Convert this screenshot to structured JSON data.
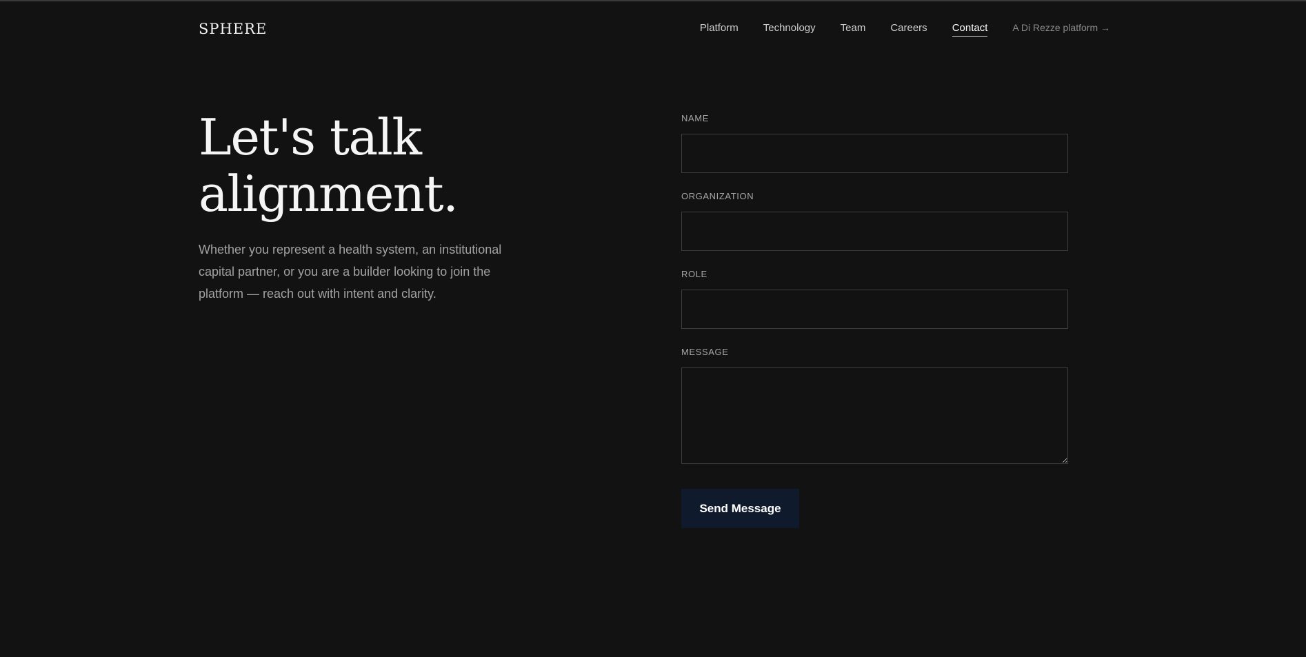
{
  "header": {
    "logo": "SPHERE",
    "nav": [
      "Platform",
      "Technology",
      "Team",
      "Careers",
      "Contact"
    ],
    "active_nav": "Contact",
    "external_link": "A Di Rezze platform →"
  },
  "hero": {
    "title_line1": "Let's talk",
    "title_line2": "alignment.",
    "body": "Whether you represent a health system, an institutional capital partner, or you are a builder looking to join the platform — reach out with intent and clarity."
  },
  "form": {
    "name_label": "NAME",
    "name_value": "",
    "organization_label": "ORGANIZATION",
    "organization_value": "",
    "role_label": "ROLE",
    "role_value": "",
    "message_label": "MESSAGE",
    "message_value": "",
    "submit_label": "Send Message"
  },
  "colors": {
    "background": "#121212",
    "button_background": "#0f1b2c",
    "muted_text": "#a3a3a3"
  }
}
